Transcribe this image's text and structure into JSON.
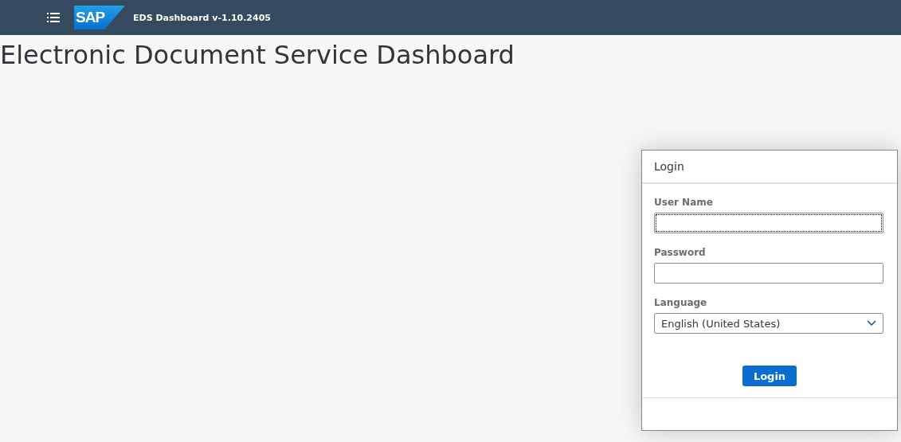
{
  "header": {
    "logo": "SAP",
    "title": "EDS Dashboard v-1.10.2405"
  },
  "page_title": "Electronic Document Service Dashboard",
  "login_dialog": {
    "title": "Login",
    "fields": [
      {
        "kind": "text",
        "label": "User Name",
        "focused": true
      },
      {
        "kind": "password",
        "label": "Password",
        "focused": false
      },
      {
        "kind": "select",
        "label": "Language",
        "value": "English (United States)",
        "focused": false
      }
    ],
    "button": "Login"
  }
}
